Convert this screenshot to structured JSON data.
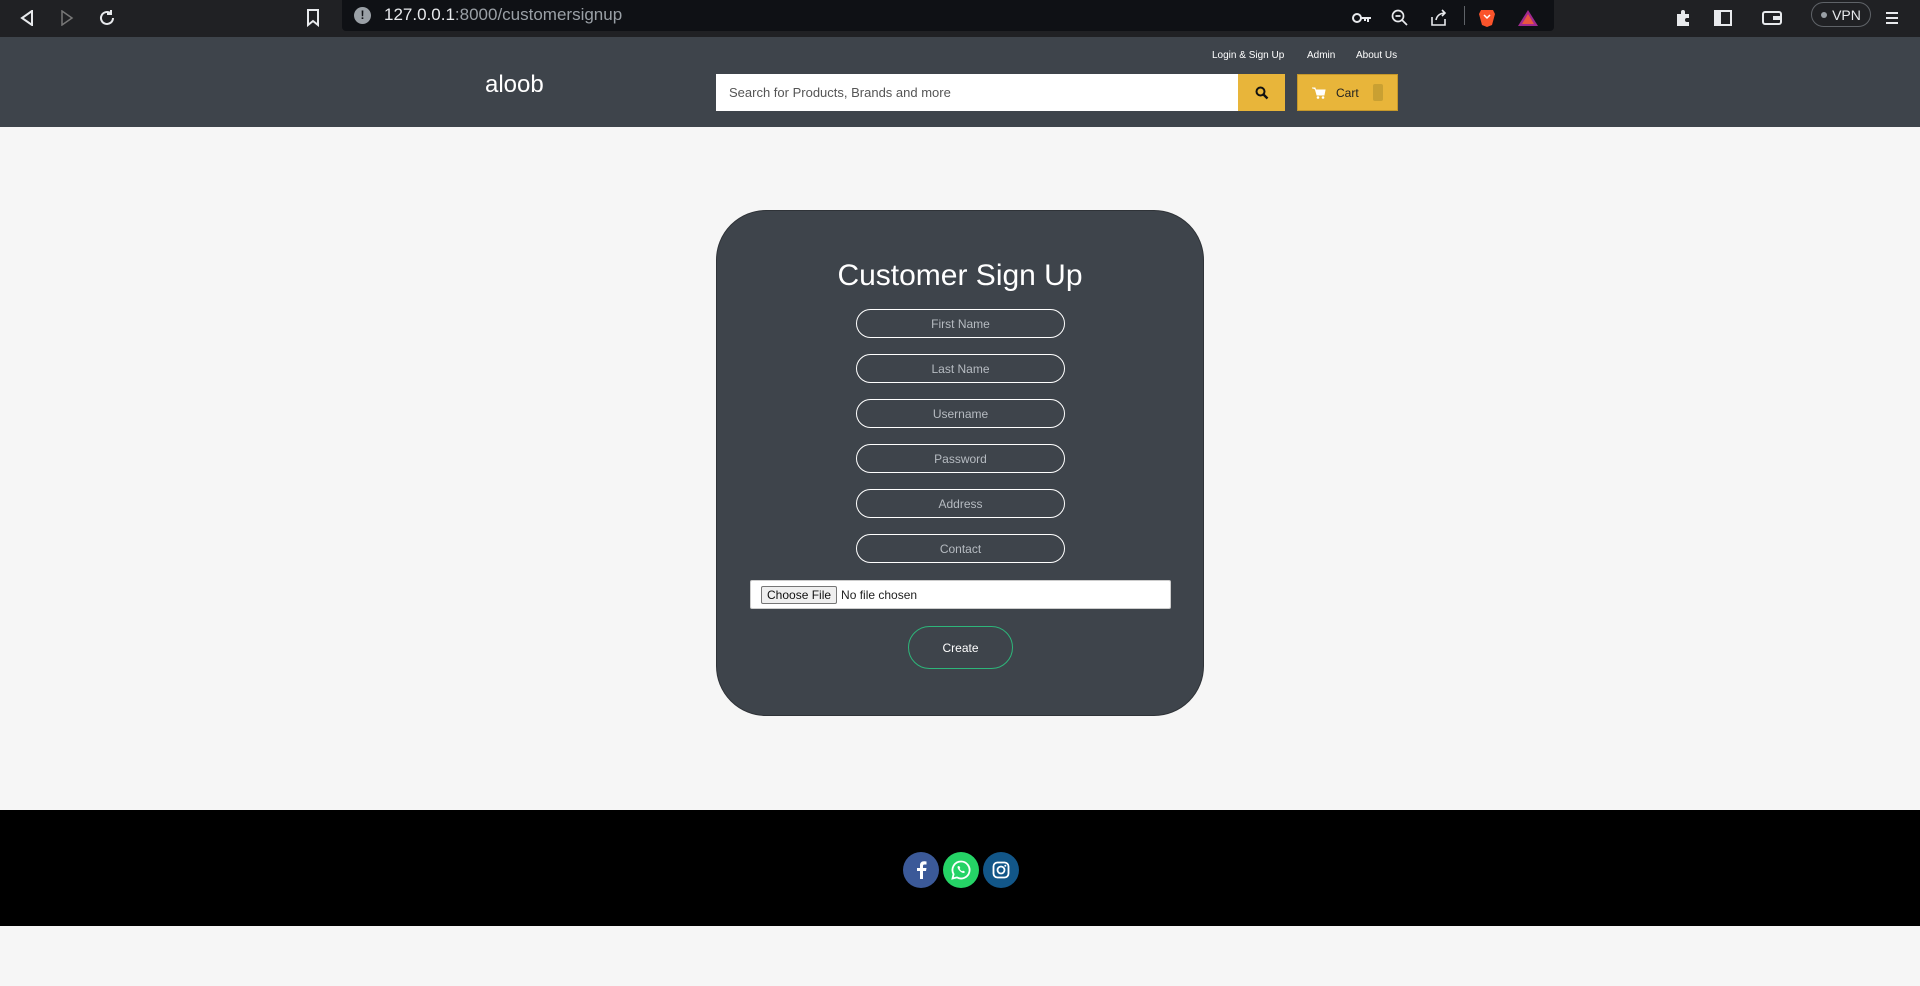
{
  "browser": {
    "url_host": "127.0.0.1",
    "url_path": ":8000/customersignup",
    "vpn_label": "VPN"
  },
  "header": {
    "logo": "aloob",
    "links": [
      "Login & Sign Up",
      "Admin",
      "About Us"
    ],
    "search_placeholder": "Search for Products, Brands and more",
    "cart_label": "Cart"
  },
  "signup": {
    "title": "Customer Sign Up",
    "fields": [
      "First Name",
      "Last Name",
      "Username",
      "Password",
      "Address",
      "Contact"
    ],
    "file_button": "Choose File",
    "file_status": "No file chosen",
    "submit_label": "Create"
  },
  "footer": {
    "social": [
      "facebook-icon",
      "whatsapp-icon",
      "instagram-icon"
    ]
  },
  "colors": {
    "header_bg": "#3e444b",
    "accent": "#e8b53a",
    "create_border": "#2db67a",
    "footer_bg": "#000000"
  }
}
